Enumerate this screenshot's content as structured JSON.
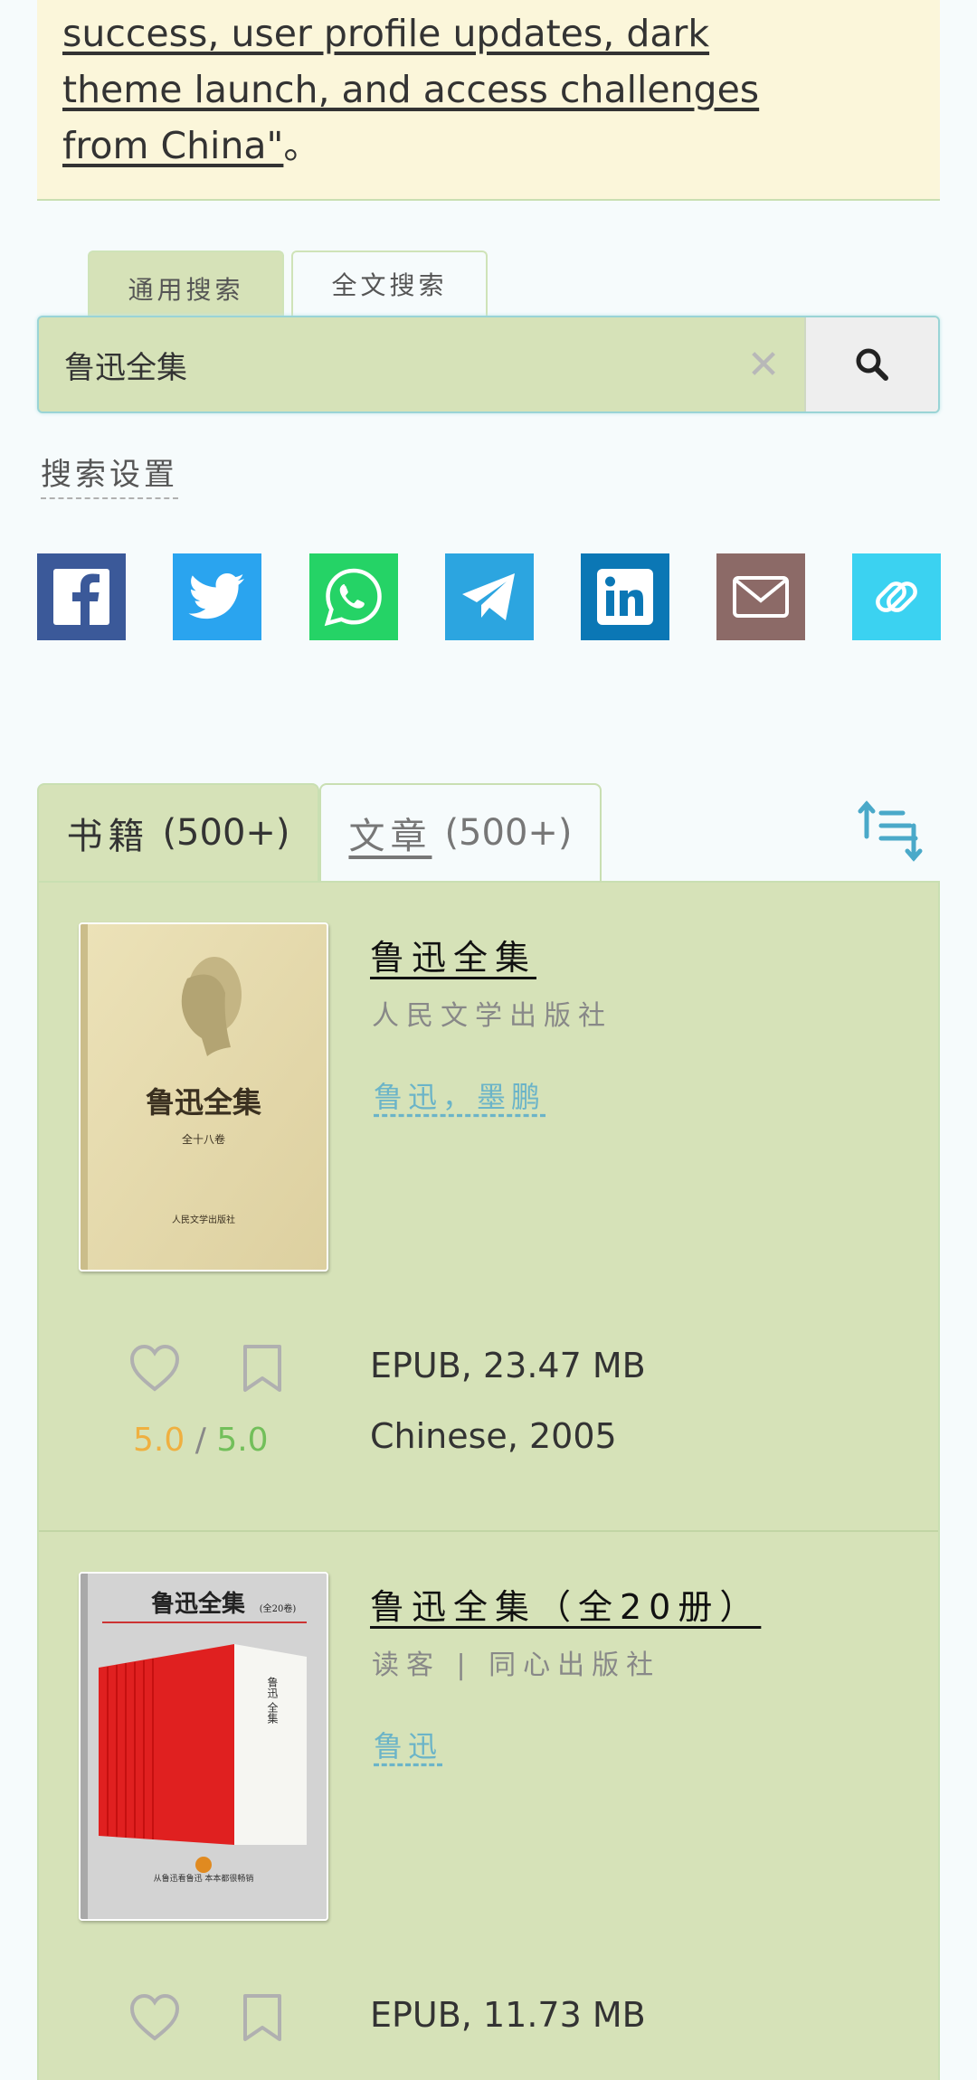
{
  "announcement": {
    "lines": [
      "success, user profile updates, dark",
      "theme launch, and access challenges",
      "from China\""
    ],
    "suffix": "。"
  },
  "search": {
    "tabs": [
      "通用搜索",
      "全文搜索"
    ],
    "active_tab": 0,
    "query": "鲁迅全集",
    "clear_glyph": "✕",
    "settings_label": "搜索设置"
  },
  "share": [
    {
      "name": "facebook",
      "color": "#3b5999"
    },
    {
      "name": "twitter",
      "color": "#2aa4ef"
    },
    {
      "name": "whatsapp",
      "color": "#25d366"
    },
    {
      "name": "telegram",
      "color": "#2ca5e0"
    },
    {
      "name": "linkedin",
      "color": "#0b77b5"
    },
    {
      "name": "email",
      "color": "#8c6a67"
    },
    {
      "name": "copy-link",
      "color": "#3bd2f1"
    }
  ],
  "result_tabs": [
    {
      "label": "书籍",
      "count": "(500+)"
    },
    {
      "label": "文章",
      "count": "(500+)"
    }
  ],
  "results": [
    {
      "title": "鲁迅全集",
      "publisher": "人民文学出版社",
      "authors": "鲁迅，墨鹏",
      "format": "EPUB, 23.47 MB",
      "language_year": "Chinese, 2005",
      "rating": "5.0",
      "rating_max": "5.0",
      "cover": {
        "title": "鲁迅全集",
        "subtitle": "全十八卷",
        "publisher": "人民文学出版社"
      }
    },
    {
      "title": "鲁迅全集（全20册）",
      "publisher": "读客 | 同心出版社",
      "authors": "鲁迅",
      "format": "EPUB, 11.73 MB",
      "cover": {
        "title": "鲁迅全集",
        "subtitle": "(全20卷)",
        "spine": "鲁迅 全集",
        "footer": "从鲁迅看鲁迅 本本都很畅销"
      }
    }
  ],
  "rating_separator": "/"
}
